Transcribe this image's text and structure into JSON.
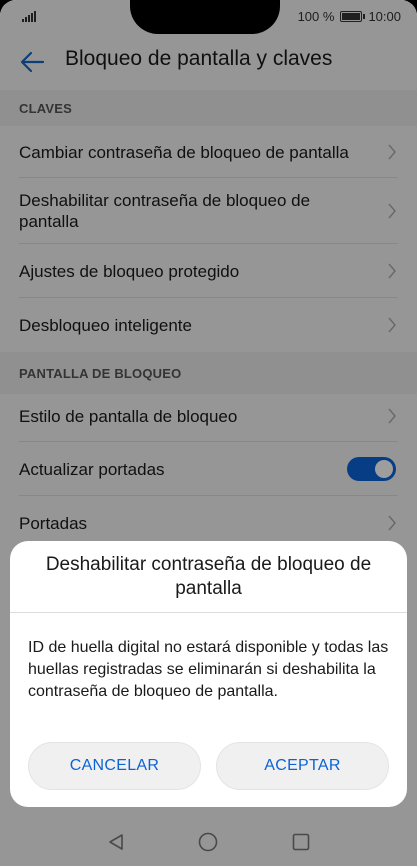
{
  "status_bar": {
    "battery": "100 %",
    "time": "10:00",
    "battery_level": 1.0
  },
  "app_bar": {
    "title": "Bloqueo de pantalla y claves",
    "back_icon": "back-arrow-icon"
  },
  "sections": [
    {
      "header": "CLAVES",
      "items": [
        {
          "label": "Cambiar contraseña de bloqueo de pantalla"
        },
        {
          "label": "Deshabilitar contraseña de bloqueo de pantalla"
        },
        {
          "label": "Ajustes de bloqueo protegido"
        },
        {
          "label": "Desbloqueo inteligente"
        }
      ]
    },
    {
      "header": "PANTALLA DE BLOQUEO",
      "items": [
        {
          "label": "Estilo de pantalla de bloqueo"
        },
        {
          "label": "Actualizar portadas",
          "toggle": true
        },
        {
          "label": "Portadas"
        }
      ]
    }
  ],
  "dialog": {
    "title": "Deshabilitar contraseña de bloqueo de pantalla",
    "body": "ID de huella digital no estará disponible y todas las huellas registradas se eliminarán si deshabilita la contraseña de bloqueo de pantalla.",
    "cancel": "CANCELAR",
    "accept": "ACEPTAR"
  },
  "colors": {
    "accent": "#0b63d6",
    "background": "#f2f2f2",
    "section_bg": "#e9e9e9"
  }
}
